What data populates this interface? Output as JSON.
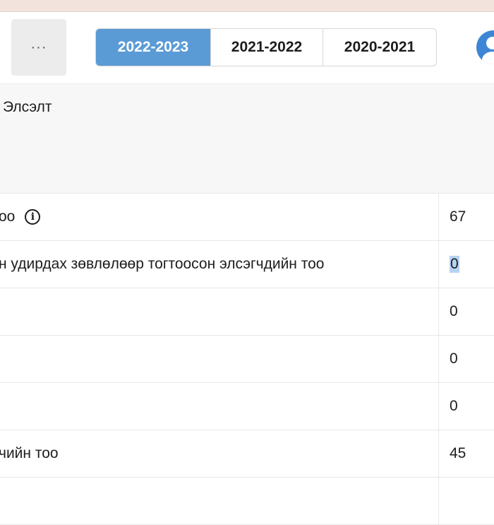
{
  "header": {
    "more_label": "···",
    "year_tabs": [
      {
        "label": "2022-2023",
        "active": true
      },
      {
        "label": "2021-2022",
        "active": false
      },
      {
        "label": "2020-2021",
        "active": false
      }
    ]
  },
  "section": {
    "title": "Элсэлт"
  },
  "rows": [
    {
      "label": "оо",
      "value": "67",
      "has_info": true
    },
    {
      "label": "н удирдах зөвлөлөөр тогтоосон элсэгчдийн тоо",
      "value": "0",
      "selected": true
    },
    {
      "label": "",
      "value": "0"
    },
    {
      "label": "",
      "value": "0"
    },
    {
      "label": "",
      "value": "0"
    },
    {
      "label": "чийн тоо",
      "value": "45"
    }
  ],
  "colors": {
    "active_tab": "#5b9bd5",
    "avatar": "#3d86d6",
    "top_strip": "#f2e3dc"
  }
}
